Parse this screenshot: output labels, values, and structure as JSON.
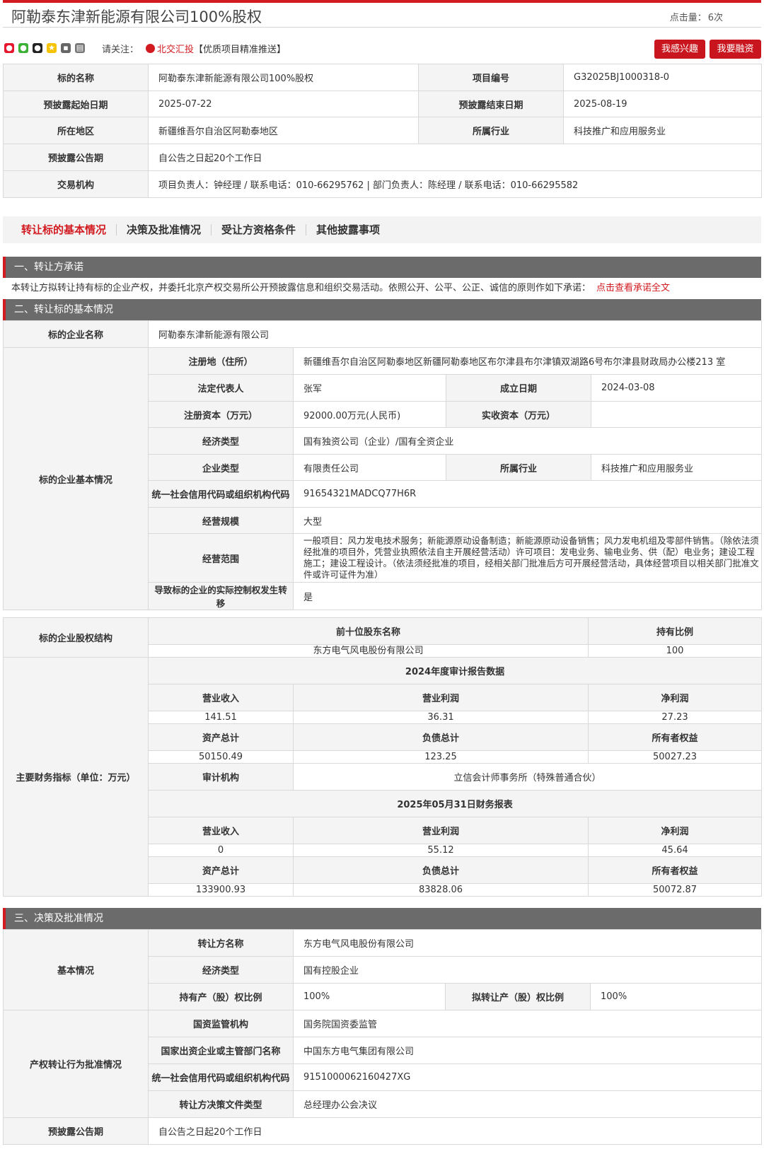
{
  "header": {
    "title": "阿勒泰东津新能源有限公司100%股权",
    "click_label": "点击量：",
    "click_value": "6次"
  },
  "share": {
    "icons": [
      "weibo-icon",
      "wechat-icon",
      "qq-icon",
      "qzone-icon",
      "copy-icon",
      "print-icon"
    ],
    "follow_label": "请关注：",
    "bj_link": "北交汇投",
    "bj_suffix": "【优质项目精准推送】"
  },
  "buttons": {
    "interest": "我感兴趣",
    "finance": "我要融资"
  },
  "summary": {
    "name_label": "标的名称",
    "name_value": "阿勒泰东津新能源有限公司100%股权",
    "code_label": "项目编号",
    "code_value": "G32025BJ1000318-0",
    "start_label": "预披露起始日期",
    "start_value": "2025-07-22",
    "end_label": "预披露结束日期",
    "end_value": "2025-08-19",
    "region_label": "所在地区",
    "region_value": "新疆维吾尔自治区阿勒泰地区",
    "industry_label": "所属行业",
    "industry_value": "科技推广和应用服务业",
    "period_label": "预披露公告期",
    "period_value": "自公告之日起20个工作日",
    "agency_label": "交易机构",
    "agency_value": "项目负责人：钟经理 / 联系电话：010-66295762 | 部门负责人：陈经理 / 联系电话：010-66295582"
  },
  "tabs": [
    "转让标的基本情况",
    "决策及批准情况",
    "受让方资格条件",
    "其他披露事项"
  ],
  "section1": {
    "title": "一、转让方承诺",
    "text": "本转让方拟转让持有标的企业产权，并委托北京产权交易所公开预披露信息和组织交易活动。依照公开、公平、公正、诚信的原则作如下承诺：",
    "link": "点击查看承诺全文"
  },
  "section2": {
    "title": "二、转让标的基本情况",
    "company_label": "标的企业名称",
    "company_value": "阿勒泰东津新能源有限公司",
    "basic_label": "标的企业基本情况",
    "reg_addr_label": "注册地（住所）",
    "reg_addr_value": "新疆维吾尔自治区阿勒泰地区新疆阿勒泰地区布尔津县布尔津镇双湖路6号布尔津县财政局办公楼213 室",
    "legal_rep_label": "法定代表人",
    "legal_rep_value": "张军",
    "founded_label": "成立日期",
    "founded_value": "2024-03-08",
    "reg_cap_label": "注册资本（万元）",
    "reg_cap_value": "92000.00万元(人民币)",
    "paid_cap_label": "实收资本（万元）",
    "paid_cap_value": "",
    "econ_type_label": "经济类型",
    "econ_type_value": "国有独资公司（企业）/国有全资企业",
    "ent_type_label": "企业类型",
    "ent_type_value": "有限责任公司",
    "industry_label": "所属行业",
    "industry_value": "科技推广和应用服务业",
    "credit_label": "统一社会信用代码或组织机构代码",
    "credit_value": "91654321MADCQ77H6R",
    "scale_label": "经营规模",
    "scale_value": "大型",
    "scope_label": "经营范围",
    "scope_value": "一般项目：风力发电技术服务；新能源原动设备制造；新能源原动设备销售；风力发电机组及零部件销售。（除依法须经批准的项目外，凭营业执照依法自主开展经营活动）许可项目：发电业务、输电业务、供（配）电业务；建设工程施工；建设工程设计。（依法须经批准的项目，经相关部门批准后方可开展经营活动，具体经营项目以相关部门批准文件或许可证件为准）",
    "control_label": "导致标的企业的实际控制权发生转移",
    "control_value": "是",
    "equity_label": "标的企业股权结构",
    "holder_col": "前十位股东名称",
    "ratio_col": "持有比例",
    "holder_name": "东方电气风电股份有限公司",
    "holder_ratio": "100",
    "fin_label": "主要财务指标（单位：万元）",
    "audit_title": "2024年度审计报告数据",
    "rev_label": "营业收入",
    "profit_label": "营业利润",
    "net_label": "净利润",
    "assets_label": "资产总计",
    "debt_label": "负债总计",
    "equity_owner_label": "所有者权益",
    "a_rev": "141.51",
    "a_profit": "36.31",
    "a_net": "27.23",
    "a_assets": "50150.49",
    "a_debt": "123.25",
    "a_equity": "50027.23",
    "auditor_label": "审计机构",
    "auditor_value": "立信会计师事务所（特殊普通合伙）",
    "report_title": "2025年05月31日财务报表",
    "r_rev": "0",
    "r_profit": "55.12",
    "r_net": "45.64",
    "r_assets": "133900.93",
    "r_debt": "83828.06",
    "r_equity": "50072.87"
  },
  "section3": {
    "title": "三、决策及批准情况",
    "basic_label": "基本情况",
    "seller_label": "转让方名称",
    "seller_value": "东方电气风电股份有限公司",
    "econ_label": "经济类型",
    "econ_value": "国有控股企业",
    "hold_label": "持有产（股）权比例",
    "hold_value": "100%",
    "plan_label": "拟转让产（股）权比例",
    "plan_value": "100%",
    "approval_label": "产权转让行为批准情况",
    "sasac_label": "国资监管机构",
    "sasac_value": "国务院国资委监管",
    "parent_label": "国家出资企业或主管部门名称",
    "parent_value": "中国东方电气集团有限公司",
    "credit_label": "统一社会信用代码或组织机构代码",
    "credit_value": "9151000062160427XG",
    "doc_label": "转让方决策文件类型",
    "doc_value": "总经理办公会决议",
    "period_label": "预披露公告期",
    "period_value": "自公告之日起20个工作日"
  }
}
